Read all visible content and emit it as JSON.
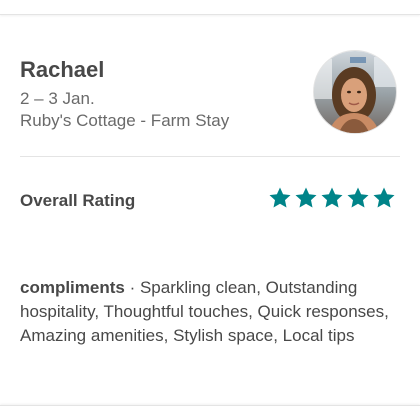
{
  "review": {
    "guest_name": "Rachael",
    "stay_dates": "2 – 3 Jan.",
    "listing_name": "Ruby's Cottage - Farm Stay",
    "rating_label": "Overall Rating",
    "rating_value": 5,
    "rating_max": 5,
    "compliments_title": "compliments",
    "compliments_separator": " · ",
    "compliments_text": "Sparkling clean, Outstanding hospitality, Thoughtful touches, Quick responses, Amazing amenities, Stylish space, Local tips"
  },
  "colors": {
    "star": "#008489",
    "text_primary": "#484848",
    "text_secondary": "#6a6a6a",
    "divider": "#e4e4e4"
  },
  "icons": {
    "star": "star-icon",
    "avatar": "guest-avatar-photo"
  }
}
